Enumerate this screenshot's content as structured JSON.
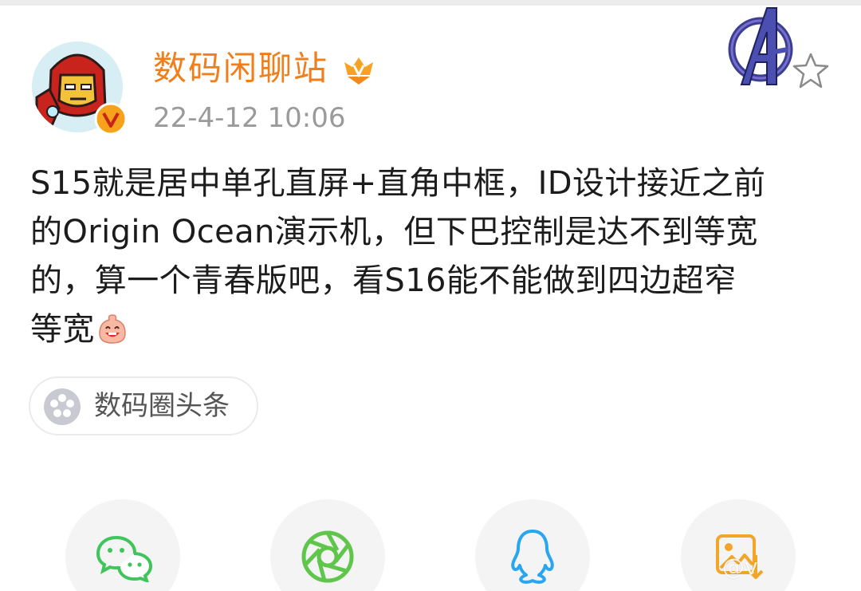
{
  "author": {
    "name": "数码闲聊站",
    "time": "22-4-12 10:06",
    "verified_badge": "v-verified-badge",
    "member_badge": "crown-badge"
  },
  "post": {
    "lines": [
      "S15就是居中单孔直屏+直角中框，ID设计接近之前",
      "的Origin Ocean演示机，但下巴控制是达不到等宽",
      "的，算一个青春版吧，看S16能不能做到四边超窄",
      "等宽"
    ],
    "trailing_emoji": "laughing-emoji"
  },
  "topic": {
    "label": "数码圈头条",
    "icon": "topic-flower-icon"
  },
  "share": {
    "buttons": [
      {
        "icon": "wechat-icon",
        "color": "#3fc55b"
      },
      {
        "icon": "moments-icon",
        "color": "#5fc64b"
      },
      {
        "icon": "qq-icon",
        "color": "#2aa6f0"
      },
      {
        "icon": "save-image-icon",
        "color": "#f3a526"
      }
    ]
  },
  "overlay": {
    "logo": "avengers-logo",
    "watermark": "@v"
  },
  "colors": {
    "author_name": "#f07f1b",
    "time": "#9a9a9a",
    "text": "#1c1c1c"
  }
}
